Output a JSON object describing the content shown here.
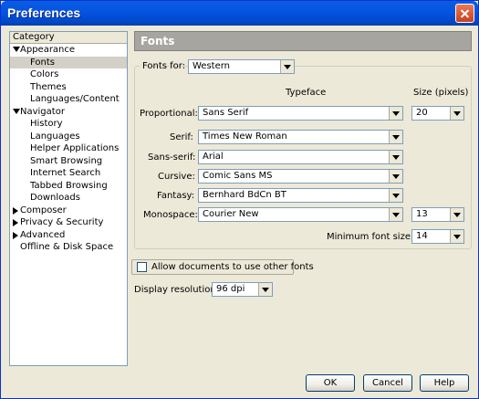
{
  "window": {
    "title": "Preferences"
  },
  "sidebar": {
    "header": "Category",
    "items": [
      {
        "label": "Appearance",
        "level": 0,
        "expander": "down"
      },
      {
        "label": "Fonts",
        "level": 1,
        "selected": true
      },
      {
        "label": "Colors",
        "level": 1
      },
      {
        "label": "Themes",
        "level": 1
      },
      {
        "label": "Languages/Content",
        "level": 1
      },
      {
        "label": "Navigator",
        "level": 0,
        "expander": "down"
      },
      {
        "label": "History",
        "level": 1
      },
      {
        "label": "Languages",
        "level": 1
      },
      {
        "label": "Helper Applications",
        "level": 1
      },
      {
        "label": "Smart Browsing",
        "level": 1
      },
      {
        "label": "Internet Search",
        "level": 1
      },
      {
        "label": "Tabbed Browsing",
        "level": 1
      },
      {
        "label": "Downloads",
        "level": 1
      },
      {
        "label": "Composer",
        "level": 0,
        "expander": "right"
      },
      {
        "label": "Privacy & Security",
        "level": 0,
        "expander": "right"
      },
      {
        "label": "Advanced",
        "level": 0,
        "expander": "right"
      },
      {
        "label": "Offline & Disk Space",
        "level": 0
      }
    ]
  },
  "main": {
    "section_title": "Fonts",
    "fonts_for": {
      "label": "Fonts for:",
      "value": "Western"
    },
    "col_typeface": "Typeface",
    "col_size": "Size (pixels)",
    "rows": [
      {
        "label": "Proportional:",
        "value": "Sans Serif",
        "size": "20"
      },
      {
        "label": "Serif:",
        "value": "Times New Roman"
      },
      {
        "label": "Sans-serif:",
        "value": "Arial"
      },
      {
        "label": "Cursive:",
        "value": "Comic Sans MS"
      },
      {
        "label": "Fantasy:",
        "value": "Bernhard BdCn BT"
      },
      {
        "label": "Monospace:",
        "value": "Courier New",
        "size": "13"
      }
    ],
    "min_font_size": {
      "label": "Minimum font size:",
      "value": "14"
    },
    "allow_docs_fonts": {
      "label": "Allow documents to use other fonts",
      "checked": false
    },
    "display_resolution": {
      "label": "Display resolution:",
      "value": "96 dpi"
    }
  },
  "buttons": {
    "ok": "OK",
    "cancel": "Cancel",
    "help": "Help"
  },
  "colors": {
    "titlebar": "#0554e3",
    "dialog_bg": "#ece9d8",
    "header_bg": "#a7a5a0"
  }
}
